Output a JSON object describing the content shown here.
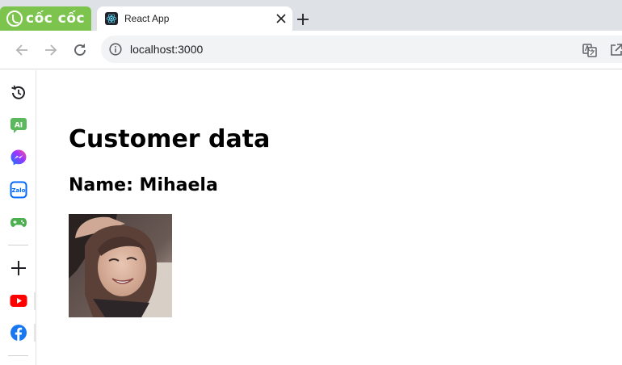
{
  "browser": {
    "brand_name": "cốc cốc",
    "tab": {
      "title": "React App"
    },
    "address": {
      "url": "localhost:3000"
    },
    "icons": {
      "back": "arrow-left-icon",
      "forward": "arrow-right-icon",
      "reload": "reload-icon",
      "info": "info-icon",
      "translate": "translate-icon",
      "share": "share-icon",
      "close": "close-icon",
      "new_tab": "plus-icon"
    },
    "colors": {
      "brand": "#7cc44d",
      "tabstrip": "#dee1e6",
      "omnibox": "#f1f3f4"
    }
  },
  "sidebar": {
    "items": [
      {
        "name": "history",
        "label": ""
      },
      {
        "name": "ai",
        "label": "AI"
      },
      {
        "name": "messenger",
        "label": ""
      },
      {
        "name": "zalo",
        "label": "Zalo"
      },
      {
        "name": "games",
        "label": ""
      },
      {
        "name": "add",
        "label": ""
      },
      {
        "name": "youtube",
        "label": ""
      },
      {
        "name": "facebook",
        "label": ""
      }
    ]
  },
  "page": {
    "heading": "Customer data",
    "name_line": "Name: Mihaela",
    "photo": "customer-photo"
  }
}
